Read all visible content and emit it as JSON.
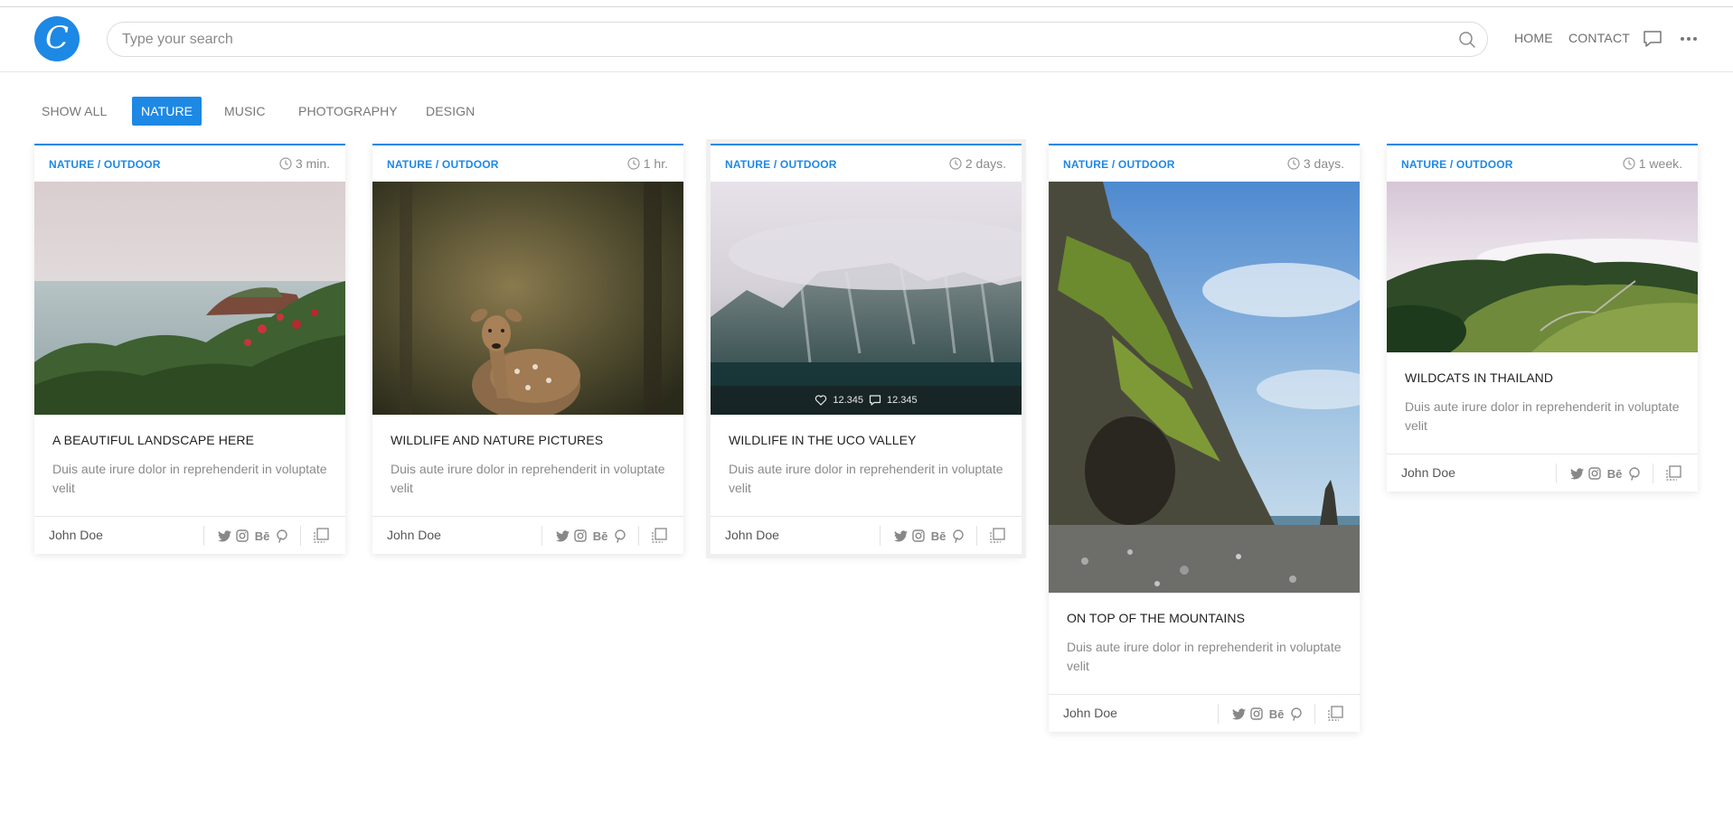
{
  "header": {
    "logo_letter": "C",
    "search_placeholder": "Type your search",
    "nav": {
      "home": "HOME",
      "contact": "CONTACT"
    },
    "icons": [
      "search-icon",
      "chat-icon",
      "more-icon"
    ]
  },
  "filters": [
    {
      "label": "SHOW ALL",
      "active": false
    },
    {
      "label": "NATURE",
      "active": true
    },
    {
      "label": "MUSIC",
      "active": false
    },
    {
      "label": "PHOTOGRAPHY",
      "active": false
    },
    {
      "label": "DESIGN",
      "active": false
    }
  ],
  "colors": {
    "accent": "#1e88e5",
    "muted": "#8a8a8a"
  },
  "cards": [
    {
      "category": "NATURE / OUTDOOR",
      "time": "3 min.",
      "image": "coastal-landscape",
      "title": "A BEAUTIFUL LANDSCAPE HERE",
      "text": "Duis aute irure dolor in reprehenderit in voluptate velit",
      "author": "John Doe",
      "social": [
        "twitter-icon",
        "instagram-icon",
        "behance-icon",
        "pinterest-icon"
      ]
    },
    {
      "category": "NATURE / OUTDOOR",
      "time": "1 hr.",
      "image": "deer-in-forest",
      "title": "WILDLIFE AND NATURE PICTURES",
      "text": "Duis aute irure dolor in reprehenderit in voluptate velit",
      "author": "John Doe",
      "social": [
        "twitter-icon",
        "instagram-icon",
        "behance-icon",
        "pinterest-icon"
      ]
    },
    {
      "category": "NATURE / OUTDOOR",
      "time": "2 days.",
      "image": "misty-mountains",
      "likes": "12.345",
      "comments": "12.345",
      "title": "WILDLIFE IN THE UCO VALLEY",
      "text": "Duis aute irure dolor in reprehenderit in voluptate velit",
      "author": "John Doe",
      "social": [
        "twitter-icon",
        "instagram-icon",
        "behance-icon",
        "pinterest-icon"
      ]
    },
    {
      "category": "NATURE / OUTDOOR",
      "time": "3 days.",
      "image": "sea-cliff",
      "title": "ON TOP OF THE MOUNTAINS",
      "text": "Duis aute irure dolor in reprehenderit in voluptate velit",
      "author": "John Doe",
      "social": [
        "twitter-icon",
        "instagram-icon",
        "behance-icon",
        "pinterest-icon"
      ]
    },
    {
      "category": "NATURE / OUTDOOR",
      "time": "1 week.",
      "image": "green-hills",
      "title": "WILDCATS IN THAILAND",
      "text": "Duis aute irure dolor in reprehenderit in voluptate velit",
      "author": "John Doe",
      "social": [
        "twitter-icon",
        "instagram-icon",
        "behance-icon",
        "pinterest-icon"
      ]
    }
  ]
}
